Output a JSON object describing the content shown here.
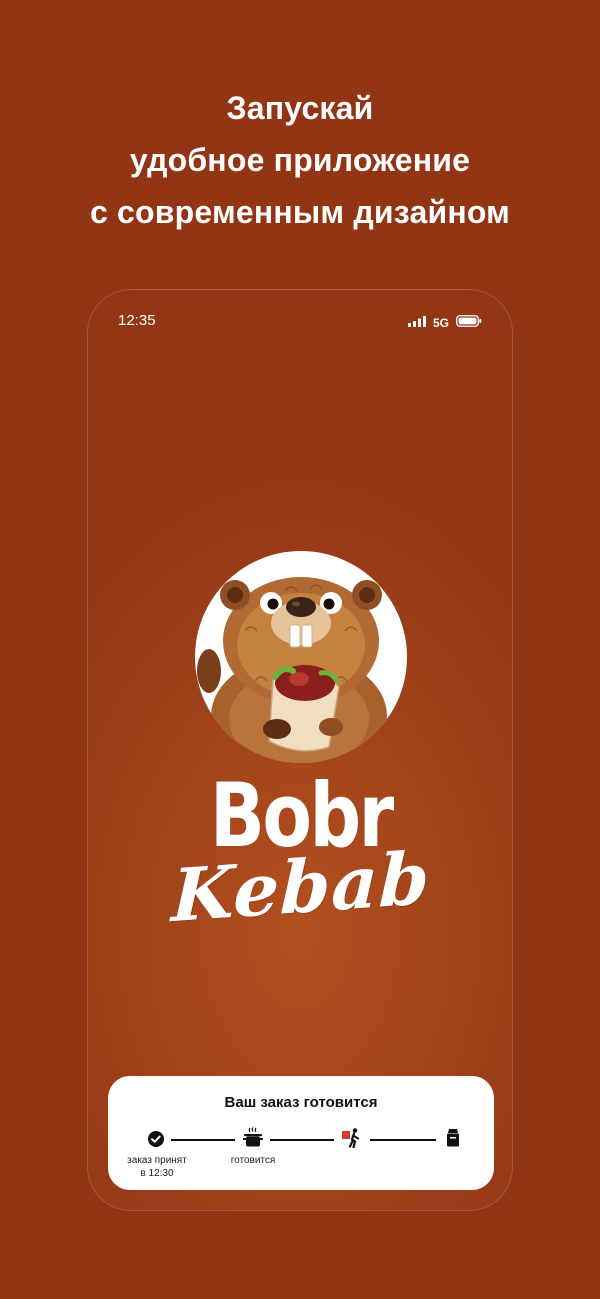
{
  "headline": {
    "line1": "Запускай",
    "line2": "удобное приложение",
    "line3": "с современным дизайном"
  },
  "phone": {
    "status_bar": {
      "time": "12:35",
      "network": "5G",
      "icons": [
        "signal-bars-icon",
        "battery-icon"
      ]
    },
    "brand": {
      "name_line1": "Bobr",
      "name_line2": "Kebab",
      "logo": "beaver-eating-kebab-logo"
    },
    "order_card": {
      "title": "Ваш заказ готовится",
      "steps": [
        {
          "icon": "check-circle-icon",
          "label": "заказ принят",
          "sublabel": "в 12:30",
          "done": true
        },
        {
          "icon": "cooking-pot-icon",
          "label": "готовится",
          "done": true
        },
        {
          "icon": "courier-icon",
          "label": "",
          "done": false
        },
        {
          "icon": "bag-icon",
          "label": "",
          "done": false
        }
      ]
    }
  },
  "colors": {
    "background": "#923515",
    "phone_glow": "#b3501f",
    "card": "#ffffff",
    "courier_accent": "#d23a2c"
  }
}
